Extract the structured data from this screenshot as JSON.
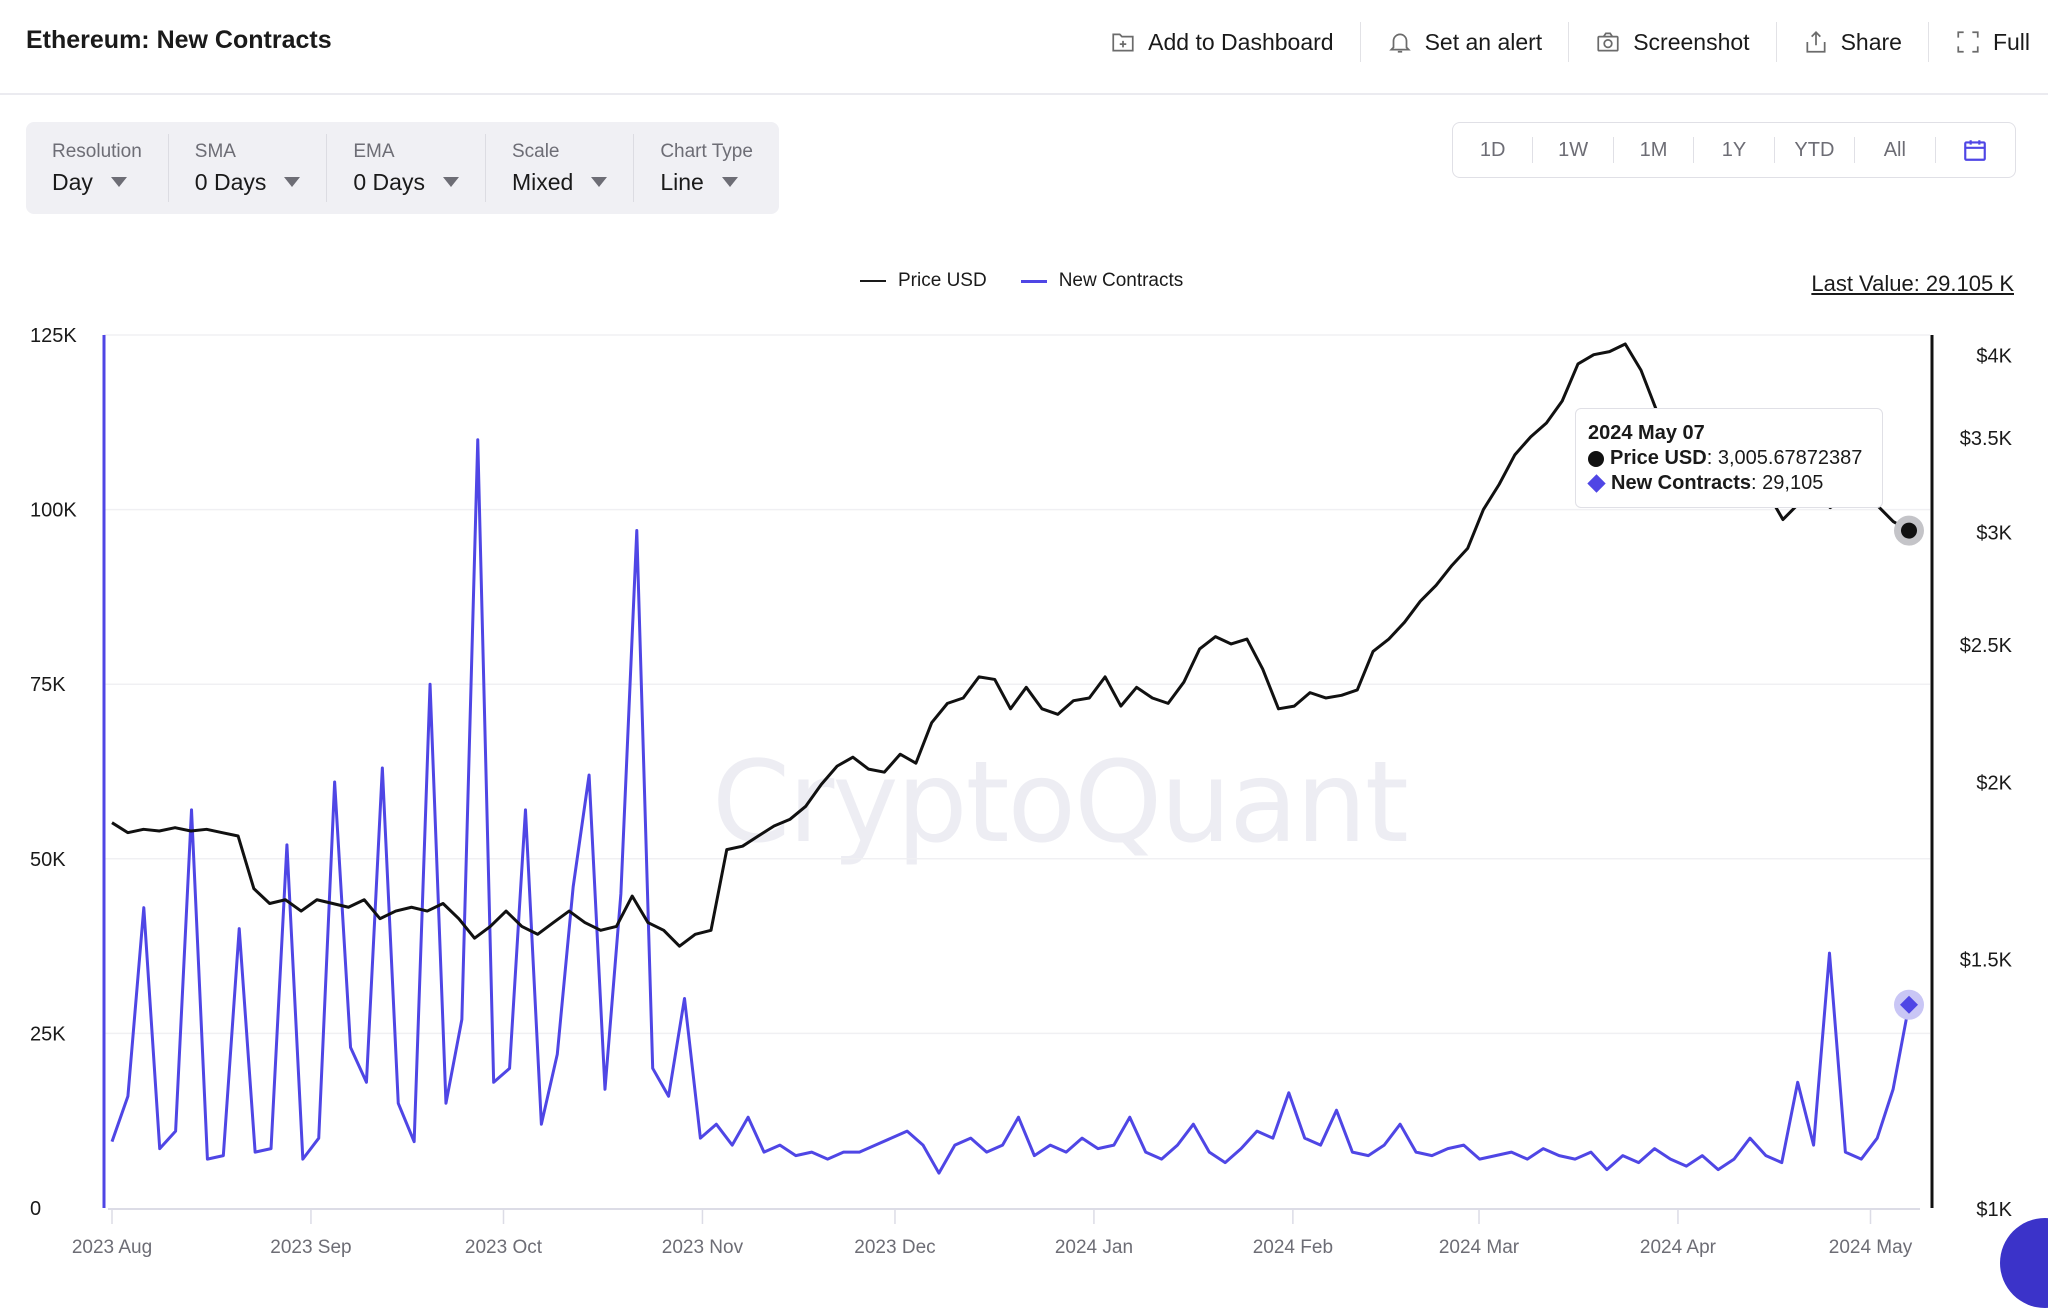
{
  "header": {
    "title": "Ethereum: New Contracts",
    "actions": [
      {
        "label": "Add to Dashboard",
        "icon": "add-to-dashboard-icon"
      },
      {
        "label": "Set an alert",
        "icon": "bell-icon"
      },
      {
        "label": "Screenshot",
        "icon": "camera-icon"
      },
      {
        "label": "Share",
        "icon": "share-icon"
      },
      {
        "label": "Full",
        "icon": "fullscreen-icon"
      }
    ]
  },
  "controls": [
    {
      "label": "Resolution",
      "value": "Day"
    },
    {
      "label": "SMA",
      "value": "0 Days"
    },
    {
      "label": "EMA",
      "value": "0 Days"
    },
    {
      "label": "Scale",
      "value": "Mixed"
    },
    {
      "label": "Chart Type",
      "value": "Line"
    }
  ],
  "ranges": [
    "1D",
    "1W",
    "1M",
    "1Y",
    "YTD",
    "All"
  ],
  "range_calendar_icon": "calendar-icon",
  "last_value": "Last Value: 29.105 K",
  "watermark": "CryptoQuant",
  "tooltip": {
    "date": "2024 May 07",
    "price_label": "Price USD",
    "price_value": ": 3,005.67872387",
    "contracts_label": "New Contracts",
    "contracts_value": ": 29,105"
  },
  "colors": {
    "price": "#111111",
    "contracts": "#4f46e5",
    "grid": "#f0f0f3"
  },
  "chart_data": {
    "type": "line",
    "title": "Ethereum: New Contracts",
    "legend": [
      "Price USD",
      "New Contracts"
    ],
    "legend_position": "top-center",
    "x_start": "2023-08-01",
    "x_end": "2024-05-07",
    "x_step_days": 3,
    "x_tick_labels": [
      "2023 Aug",
      "2023 Sep",
      "2023 Oct",
      "2023 Nov",
      "2023 Dec",
      "2024 Jan",
      "2024 Feb",
      "2024 Mar",
      "2024 Apr",
      "2024 May"
    ],
    "x_tick_days": [
      0,
      31,
      61,
      92,
      122,
      153,
      184,
      213,
      244,
      274
    ],
    "left_axis": {
      "label": "New Contracts",
      "ticks": [
        "0",
        "25K",
        "50K",
        "75K",
        "100K",
        "125K"
      ],
      "tick_values": [
        0,
        25000,
        50000,
        75000,
        100000,
        125000
      ],
      "range": [
        0,
        125000
      ],
      "scale": "linear"
    },
    "right_axis": {
      "label": "Price USD",
      "ticks": [
        "$1K",
        "$1.5K",
        "$2K",
        "$2.5K",
        "$3K",
        "$3.5K",
        "$4K"
      ],
      "tick_values": [
        1000,
        1500,
        2000,
        2500,
        3000,
        3500,
        4000
      ],
      "range": [
        1000,
        4150
      ],
      "scale": "log"
    },
    "series": [
      {
        "name": "New Contracts",
        "axis": "left",
        "values": [
          9500,
          16000,
          43000,
          8500,
          11000,
          57000,
          7000,
          7500,
          40000,
          8000,
          8500,
          52000,
          7000,
          10000,
          61000,
          23000,
          18000,
          63000,
          15000,
          9500,
          75000,
          15000,
          27000,
          110000,
          18000,
          20000,
          57000,
          12000,
          22000,
          46000,
          62000,
          17000,
          45000,
          97000,
          20000,
          16000,
          30000,
          10000,
          12000,
          9000,
          13000,
          8000,
          9000,
          7500,
          8000,
          7000,
          8000,
          8000,
          9000,
          10000,
          11000,
          9000,
          5000,
          9000,
          10000,
          8000,
          9000,
          13000,
          7500,
          9000,
          8000,
          10000,
          8500,
          9000,
          13000,
          8000,
          7000,
          9000,
          12000,
          8000,
          6500,
          8500,
          11000,
          10000,
          16500,
          10000,
          9000,
          14000,
          8000,
          7500,
          9000,
          12000,
          8000,
          7500,
          8500,
          9000,
          7000,
          7500,
          8000,
          7000,
          8500,
          7500,
          7000,
          8000,
          5500,
          7500,
          6500,
          8500,
          7000,
          6000,
          7500,
          5500,
          7000,
          10000,
          7500,
          6500,
          18000,
          9000,
          36500,
          8000,
          7000,
          10000,
          17000,
          29105
        ],
        "last_value": 29105
      },
      {
        "name": "Price USD",
        "axis": "right",
        "values": [
          1870,
          1840,
          1850,
          1845,
          1855,
          1845,
          1850,
          1840,
          1830,
          1680,
          1640,
          1650,
          1620,
          1650,
          1640,
          1630,
          1650,
          1600,
          1620,
          1630,
          1620,
          1640,
          1600,
          1550,
          1580,
          1620,
          1580,
          1560,
          1590,
          1620,
          1590,
          1570,
          1580,
          1660,
          1590,
          1570,
          1530,
          1560,
          1570,
          1790,
          1800,
          1830,
          1860,
          1880,
          1920,
          1990,
          2050,
          2080,
          2040,
          2030,
          2090,
          2060,
          2200,
          2270,
          2290,
          2370,
          2360,
          2250,
          2330,
          2250,
          2230,
          2280,
          2290,
          2370,
          2260,
          2330,
          2290,
          2270,
          2350,
          2480,
          2530,
          2500,
          2520,
          2400,
          2250,
          2260,
          2310,
          2290,
          2300,
          2320,
          2470,
          2520,
          2590,
          2680,
          2750,
          2840,
          2920,
          3110,
          3240,
          3400,
          3500,
          3580,
          3710,
          3940,
          4000,
          4020,
          4070,
          3900,
          3650,
          3500,
          3200,
          3180,
          3300,
          3450,
          3500,
          3200,
          3060,
          3140,
          3200,
          3120,
          3170,
          3220,
          3130,
          3050,
          3005.67872387
        ],
        "last_value": 3005.67872387
      }
    ],
    "grid": true
  }
}
